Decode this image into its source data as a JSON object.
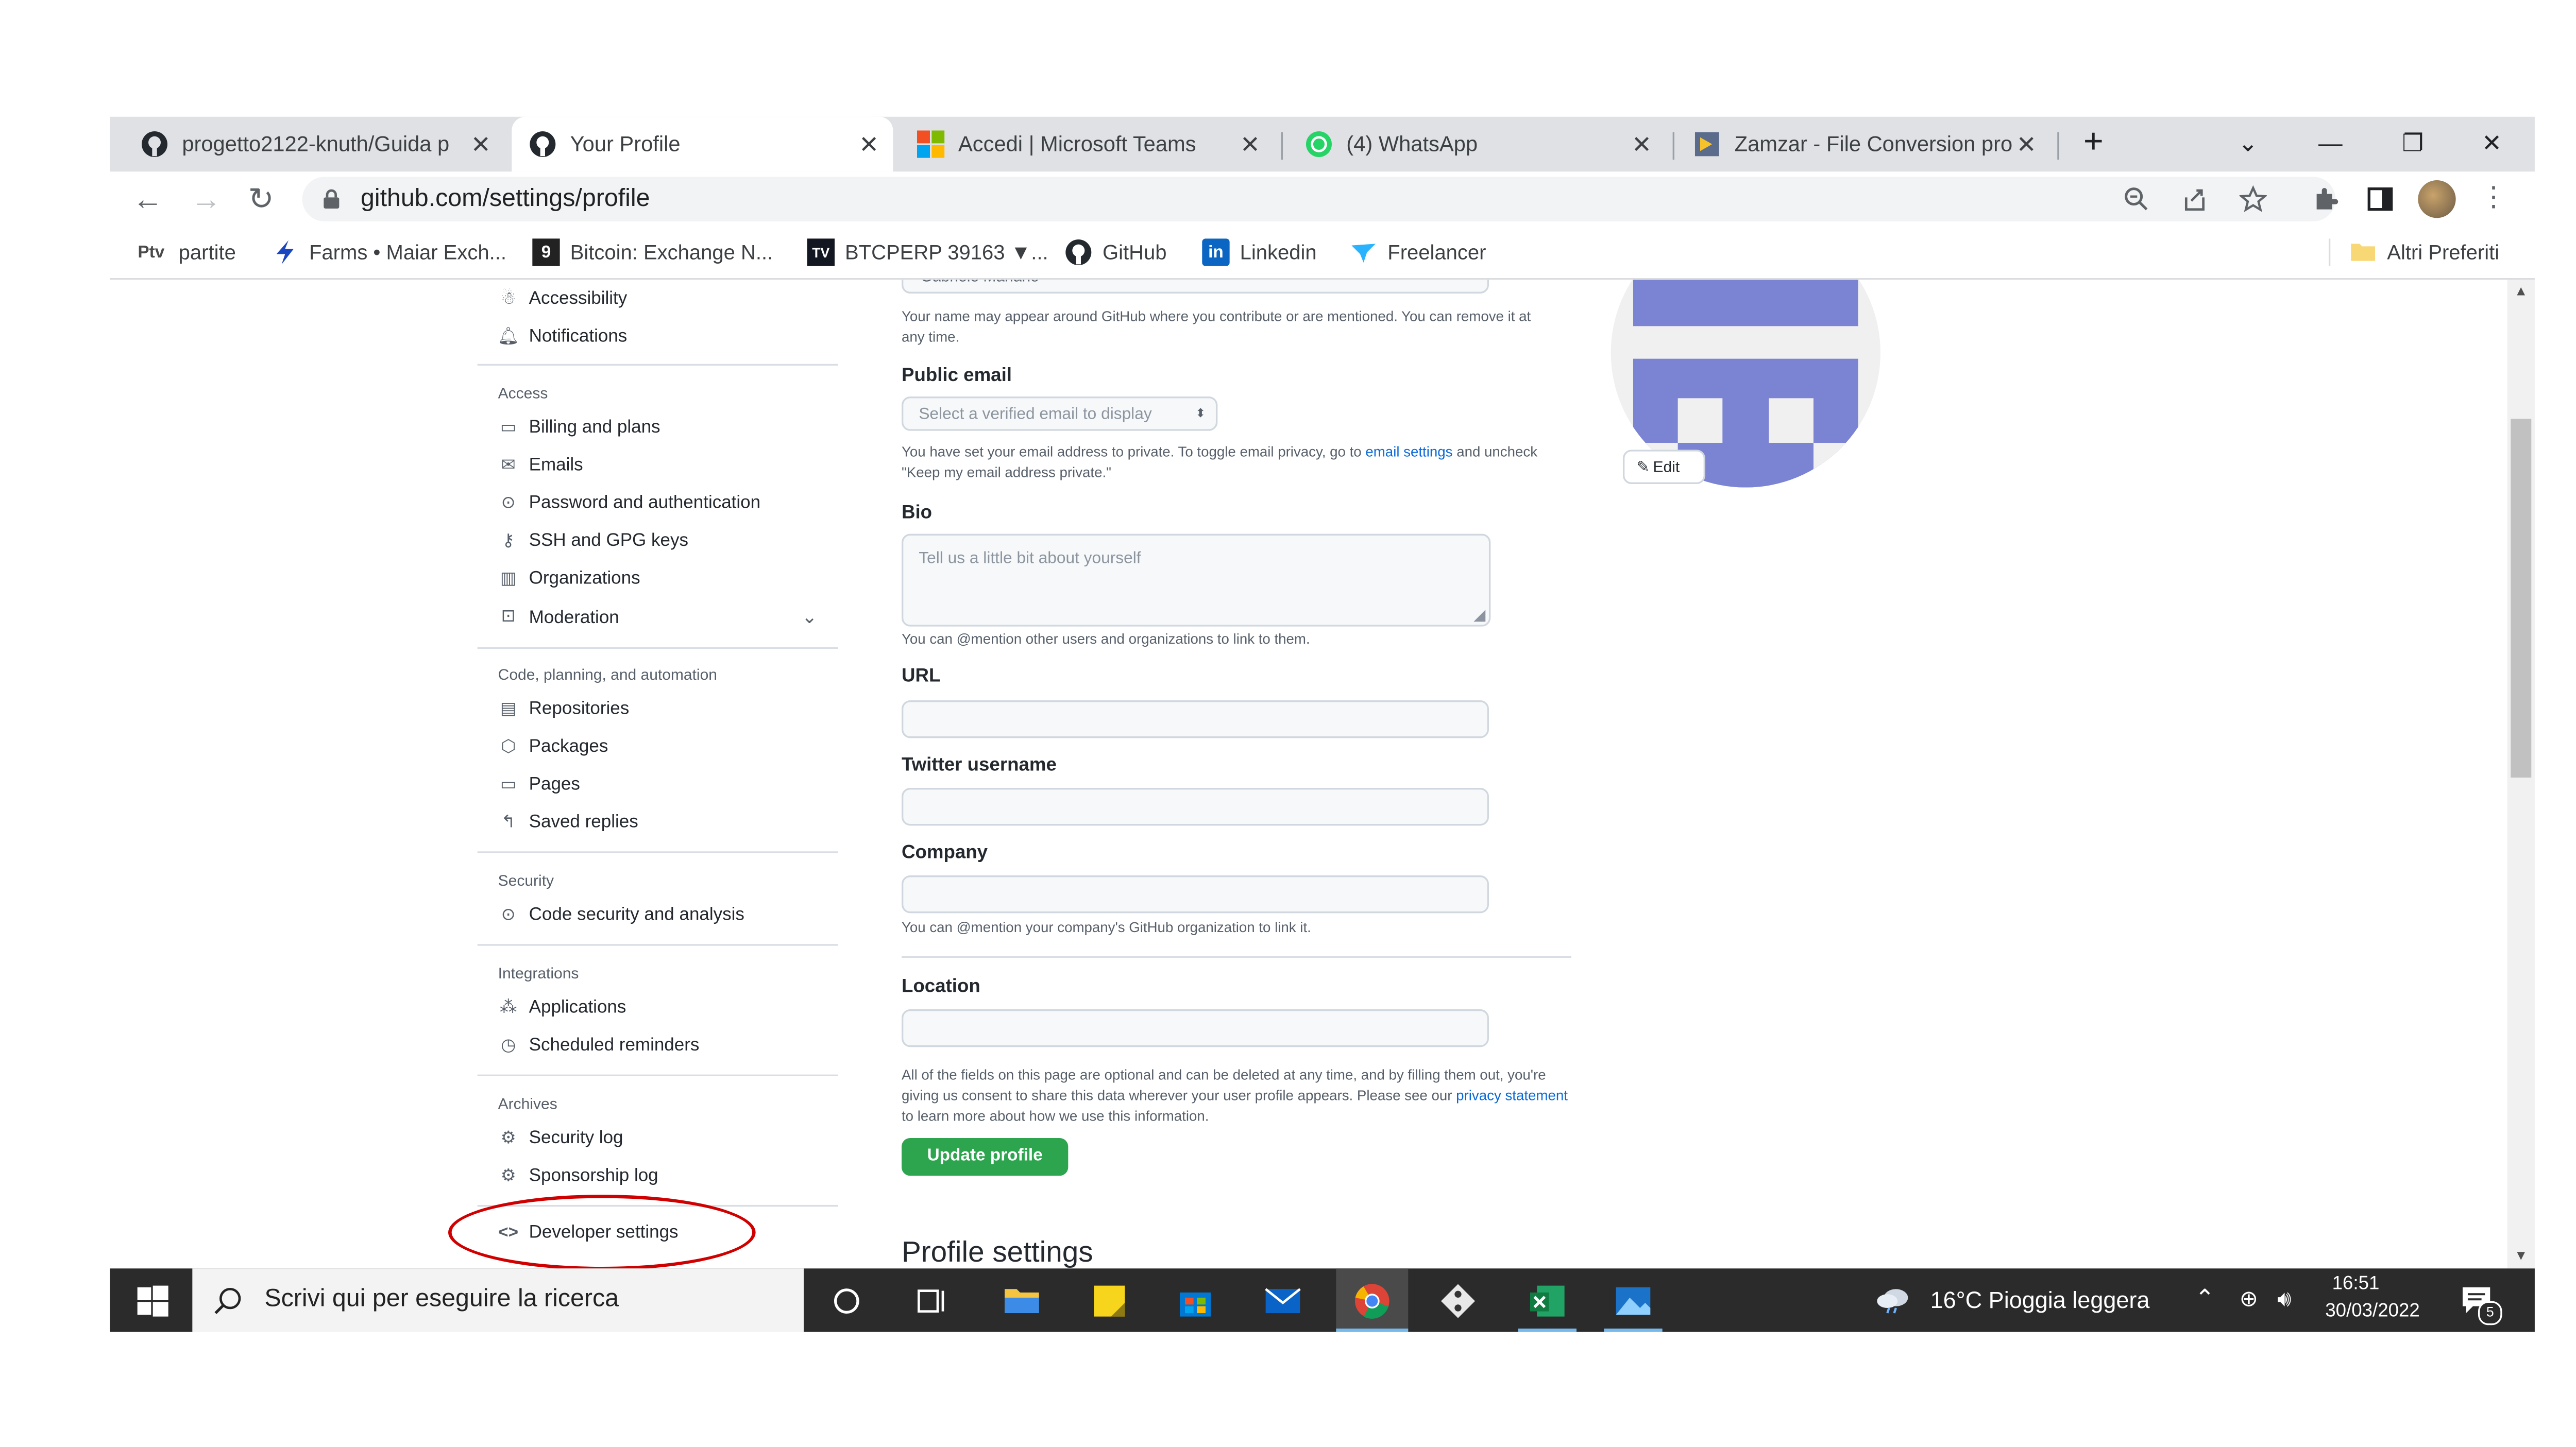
{
  "browser": {
    "tabs": [
      {
        "title": "progetto2122-knuth/Guida p",
        "icon": "github-icon",
        "active": false
      },
      {
        "title": "Your Profile",
        "icon": "github-icon",
        "active": true
      },
      {
        "title": "Accedi | Microsoft Teams",
        "icon": "microsoft-icon",
        "active": false
      },
      {
        "title": "(4) WhatsApp",
        "icon": "whatsapp-icon",
        "active": false
      },
      {
        "title": "Zamzar - File Conversion pro",
        "icon": "zamzar-icon",
        "active": false
      }
    ],
    "new_tab": "+",
    "url": "github.com/settings/profile",
    "bookmarks": [
      {
        "label": "partite",
        "icon": "ptv-icon"
      },
      {
        "label": "Farms • Maiar Exch...",
        "icon": "bolt-icon"
      },
      {
        "label": "Bitcoin: Exchange N...",
        "icon": "bitcoin-site-icon"
      },
      {
        "label": "BTCPERP 39163 ▼...",
        "icon": "tradingview-icon"
      },
      {
        "label": "GitHub",
        "icon": "github-icon"
      },
      {
        "label": "Linkedin",
        "icon": "linkedin-icon"
      },
      {
        "label": "Freelancer",
        "icon": "freelancer-icon"
      }
    ],
    "other_bookmarks": "Altri Preferiti",
    "ptv_text": "Ptv",
    "tv_text": "TV",
    "linkedin_text": "in"
  },
  "sidebar": {
    "top_items": [
      {
        "label": "Accessibility",
        "icon": "accessibility-icon"
      },
      {
        "label": "Notifications",
        "icon": "bell-icon"
      }
    ],
    "sections": [
      {
        "heading": "Access",
        "items": [
          {
            "label": "Billing and plans",
            "icon": "credit-card-icon"
          },
          {
            "label": "Emails",
            "icon": "mail-icon"
          },
          {
            "label": "Password and authentication",
            "icon": "shield-lock-icon"
          },
          {
            "label": "SSH and GPG keys",
            "icon": "key-icon"
          },
          {
            "label": "Organizations",
            "icon": "organization-icon"
          },
          {
            "label": "Moderation",
            "icon": "report-icon"
          }
        ]
      },
      {
        "heading": "Code, planning, and automation",
        "items": [
          {
            "label": "Repositories",
            "icon": "repo-icon"
          },
          {
            "label": "Packages",
            "icon": "package-icon"
          },
          {
            "label": "Pages",
            "icon": "browser-icon"
          },
          {
            "label": "Saved replies",
            "icon": "reply-icon"
          }
        ]
      },
      {
        "heading": "Security",
        "items": [
          {
            "label": "Code security and analysis",
            "icon": "shield-lock-icon"
          }
        ]
      },
      {
        "heading": "Integrations",
        "items": [
          {
            "label": "Applications",
            "icon": "apps-icon"
          },
          {
            "label": "Scheduled reminders",
            "icon": "clock-icon"
          }
        ]
      },
      {
        "heading": "Archives",
        "items": [
          {
            "label": "Security log",
            "icon": "log-icon"
          },
          {
            "label": "Sponsorship log",
            "icon": "log-icon"
          }
        ]
      }
    ],
    "developer_settings": "Developer settings"
  },
  "form": {
    "name_value": "Gabriele Mariano",
    "name_note": "Your name may appear around GitHub where you contribute or are mentioned. You can remove it at any time.",
    "public_email_label": "Public email",
    "public_email_select": "Select a verified email to display",
    "email_note_1": "You have set your email address to private. To toggle email privacy, go to",
    "email_settings_link": "email settings",
    "email_note_2": "and uncheck \"Keep my email address private.\"",
    "bio_label": "Bio",
    "bio_placeholder": "Tell us a little bit about yourself",
    "bio_note": "You can @mention other users and organizations to link to them.",
    "url_label": "URL",
    "twitter_label": "Twitter username",
    "company_label": "Company",
    "company_note": "You can @mention your company's GitHub organization to link it.",
    "location_label": "Location",
    "footer_note_1": "All of the fields on this page are optional and can be deleted at any time, and by filling them out, you're giving us consent to share this data wherever your user profile appears. Please see our",
    "privacy_link": "privacy statement",
    "footer_note_2": "to learn more about how we use this information.",
    "update_button": "Update profile",
    "next_heading": "Profile settings"
  },
  "avatar": {
    "edit_label": "Edit",
    "color": "#7b83d3"
  },
  "taskbar": {
    "search_text": "Scrivi qui per eseguire la ricerca",
    "weather_text": "16°C  Pioggia leggera",
    "time": "16:51",
    "date": "30/03/2022",
    "notification_count": "5"
  },
  "colors": {
    "annotation": "#d00000",
    "update_button": "#2da44e",
    "link": "#0969da"
  }
}
